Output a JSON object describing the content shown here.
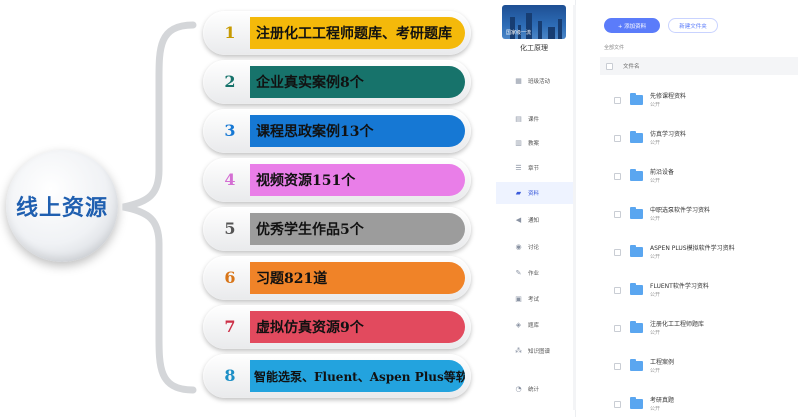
{
  "infographic": {
    "center_label": "线上资源",
    "items": [
      {
        "num": "1",
        "text": "注册化工工程师题库、考研题库",
        "color": "#f4b90a",
        "num_color": "#c79a00"
      },
      {
        "num": "2",
        "text": "企业真实案例8个",
        "color": "#17736b",
        "num_color": "#17736b"
      },
      {
        "num": "3",
        "text": "课程思政案例13个",
        "color": "#1678d4",
        "num_color": "#1678d4"
      },
      {
        "num": "4",
        "text": "视频资源151个",
        "color": "#e97ee8",
        "num_color": "#d46fd3"
      },
      {
        "num": "5",
        "text": "优秀学生作品5个",
        "color": "#9c9c9c",
        "num_color": "#555555"
      },
      {
        "num": "6",
        "text": "习题821道",
        "color": "#f08328",
        "num_color": "#d87518"
      },
      {
        "num": "7",
        "text": "虚拟仿真资源9个",
        "color": "#e24a5e",
        "num_color": "#cc2f46"
      },
      {
        "num": "8",
        "text": "智能选泵、Fluent、Aspen Plus等软件",
        "color": "#23a3de",
        "num_color": "#1c8fc6"
      }
    ]
  },
  "app": {
    "course_image_tag": "国家级一流",
    "course_name": "化工原理",
    "nav": [
      {
        "icon": "grid-icon",
        "glyph": "▦",
        "label": "班级活动",
        "active": false
      },
      {
        "icon": "courseware-icon",
        "glyph": "▤",
        "label": "课件",
        "active": false
      },
      {
        "icon": "lesson-plan-icon",
        "glyph": "▥",
        "label": "教案",
        "active": false
      },
      {
        "icon": "chapter-icon",
        "glyph": "☰",
        "label": "章节",
        "active": false
      },
      {
        "icon": "folder-icon",
        "glyph": "▰",
        "label": "资料",
        "active": true
      },
      {
        "icon": "speaker-icon",
        "glyph": "◀",
        "label": "通知",
        "active": false
      },
      {
        "icon": "discussion-icon",
        "glyph": "◉",
        "label": "讨论",
        "active": false
      },
      {
        "icon": "homework-icon",
        "glyph": "✎",
        "label": "作业",
        "active": false
      },
      {
        "icon": "exam-icon",
        "glyph": "▣",
        "label": "考试",
        "active": false
      },
      {
        "icon": "question-bank-icon",
        "glyph": "◈",
        "label": "题库",
        "active": false
      },
      {
        "icon": "knowledge-graph-icon",
        "glyph": "⁂",
        "label": "知识图谱",
        "active": false
      },
      {
        "icon": "statistics-icon",
        "glyph": "◔",
        "label": "统计",
        "active": false
      }
    ],
    "add_button": "+ 添加资料",
    "new_folder_button": "新建文件夹",
    "breadcrumb": "全部文件",
    "column_header": "文件名",
    "files": [
      {
        "name": "先修课程资料",
        "visibility": "公开"
      },
      {
        "name": "仿真学习资料",
        "visibility": "公开"
      },
      {
        "name": "前沿设备",
        "visibility": "公开"
      },
      {
        "name": "中职选泵软件学习资料",
        "visibility": "公开"
      },
      {
        "name": "ASPEN PLUS模拟软件学习资料",
        "visibility": "公开"
      },
      {
        "name": "FLUENT软件学习资料",
        "visibility": "公开"
      },
      {
        "name": "注册化工工程师题库",
        "visibility": "公开"
      },
      {
        "name": "工程案例",
        "visibility": "公开"
      },
      {
        "name": "考研真题",
        "visibility": "公开"
      }
    ]
  }
}
